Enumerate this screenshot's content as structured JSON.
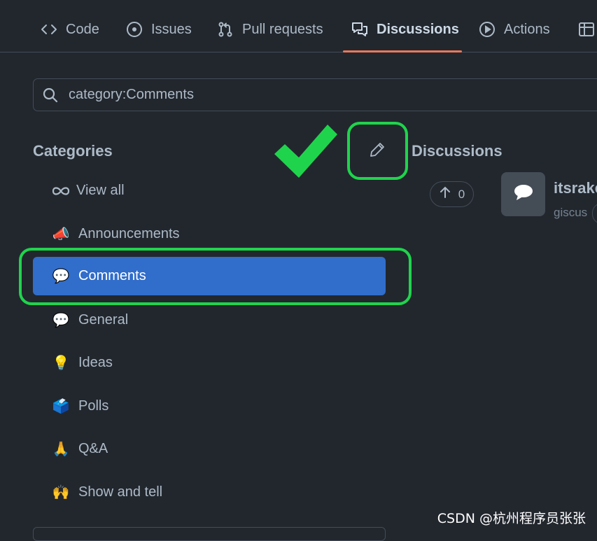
{
  "nav": {
    "tabs": [
      {
        "label": "Code",
        "icon": "code-icon"
      },
      {
        "label": "Issues",
        "icon": "issue-opened-icon"
      },
      {
        "label": "Pull requests",
        "icon": "git-pull-request-icon"
      },
      {
        "label": "Discussions",
        "icon": "comment-discussion-icon",
        "active": true
      },
      {
        "label": "Actions",
        "icon": "play-icon"
      },
      {
        "label": "",
        "icon": "table-icon"
      }
    ]
  },
  "search": {
    "value": "category:Comments",
    "icon": "search-icon"
  },
  "categories": {
    "heading": "Categories",
    "items": [
      {
        "label": "View all",
        "icon": "infinity-icon"
      },
      {
        "label": "Announcements",
        "emoji": "📣"
      },
      {
        "label": "Comments",
        "emoji": "💬",
        "selected": true
      },
      {
        "label": "General",
        "emoji": "💬"
      },
      {
        "label": "Ideas",
        "emoji": "💡"
      },
      {
        "label": "Polls",
        "emoji": "🗳️"
      },
      {
        "label": "Q&A",
        "emoji": "🙏"
      },
      {
        "label": "Show and tell",
        "emoji": "🙌"
      }
    ]
  },
  "discussions": {
    "heading": "Discussions",
    "items": [
      {
        "votes": "0",
        "title": "itsrake",
        "meta": "giscus"
      }
    ]
  },
  "annotation": {
    "color": "#1fd44c"
  },
  "watermark": "CSDN @杭州程序员张张"
}
